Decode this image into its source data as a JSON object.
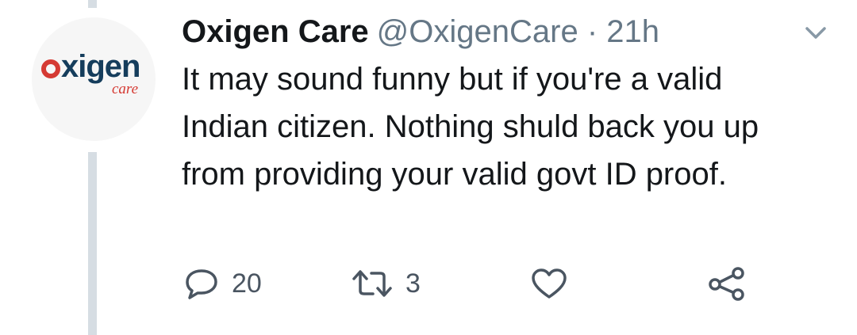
{
  "tweet": {
    "author": {
      "display_name": "Oxigen Care",
      "handle": "@OxigenCare",
      "avatar": {
        "logo_text": "xigen",
        "logo_subtext": "care"
      }
    },
    "separator": "·",
    "time": "21h",
    "text": "It may sound funny but if you're a valid Indian citizen. Nothing shuld back you up from providing your valid govt ID proof.",
    "actions": {
      "reply": {
        "icon": "reply-icon",
        "count": "20"
      },
      "retweet": {
        "icon": "retweet-icon",
        "count": "3"
      },
      "like": {
        "icon": "heart-icon"
      },
      "share": {
        "icon": "share-icon"
      }
    }
  },
  "colors": {
    "text": "#14171a",
    "secondary": "#657786",
    "icon": "#4a5561",
    "thread_line": "#d6dde3",
    "brand_blue": "#153d5c",
    "brand_red": "#d53a33"
  }
}
